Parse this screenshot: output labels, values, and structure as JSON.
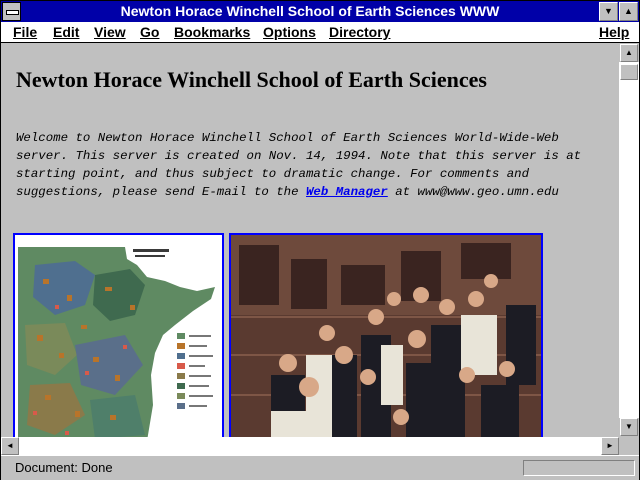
{
  "window": {
    "title": "Newton Horace Winchell School of Earth Sciences WWW",
    "minimize_glyph": "▼",
    "maximize_glyph": "▲"
  },
  "menu": {
    "file": "File",
    "edit": "Edit",
    "view": "View",
    "go": "Go",
    "bookmarks": "Bookmarks",
    "options": "Options",
    "directory": "Directory",
    "help": "Help"
  },
  "page": {
    "title": "Newton Horace Winchell School of Earth Sciences",
    "intro_before": "Welcome to Newton Horace Winchell School of Earth Sciences World-Wide-Web server. This server is created on Nov. 14, 1994. Note that this server is at starting point, and thus subject to dramatic change. For comments and suggestions, please send E-mail to the ",
    "link_text": "Web Manager",
    "intro_after": " at www@www.geo.umn.edu"
  },
  "scrollbar": {
    "up_glyph": "▲",
    "down_glyph": "▼",
    "left_glyph": "◄",
    "right_glyph": "►"
  },
  "status": {
    "text": "Document: Done"
  },
  "colors": {
    "titlebar": "#0000a8",
    "link": "#0000ee",
    "image_border": "#0000ff",
    "background": "#c0c0c0"
  }
}
